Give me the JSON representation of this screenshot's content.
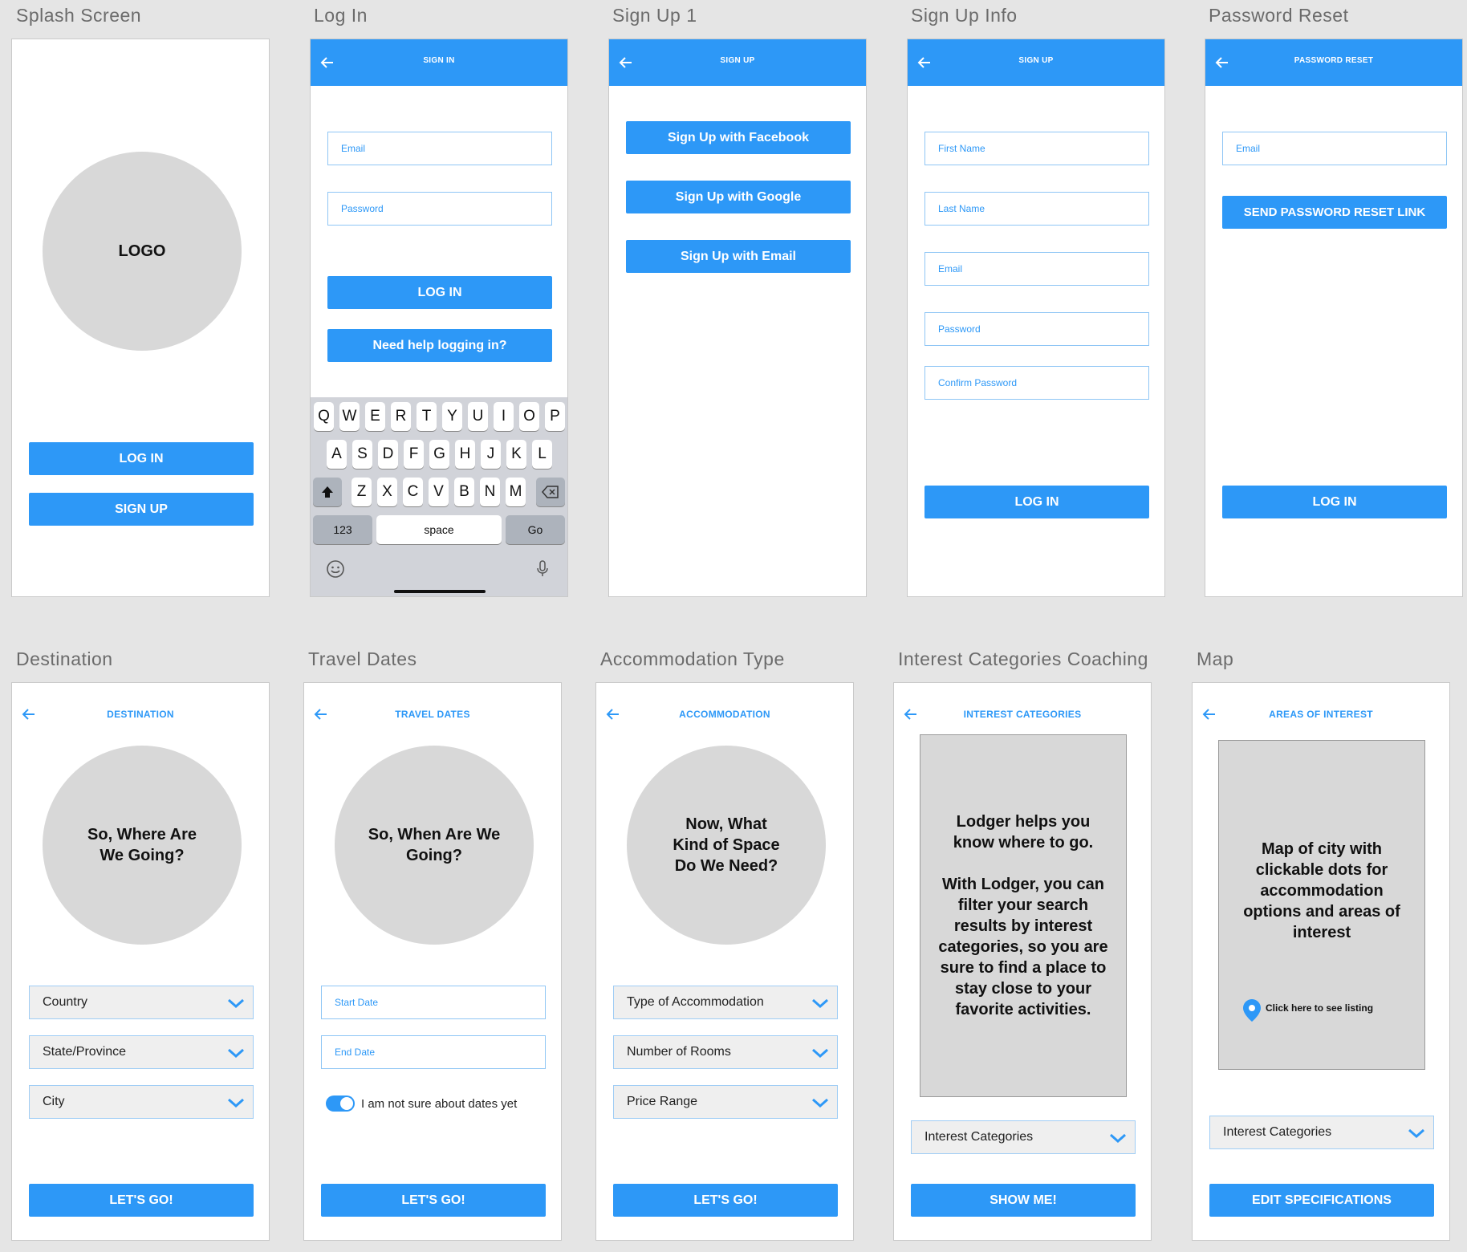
{
  "labels": {
    "splash": "Splash Screen",
    "login": "Log In",
    "signup1": "Sign Up 1",
    "signup_info": "Sign Up Info",
    "password_reset": "Password Reset",
    "destination": "Destination",
    "travel_dates": "Travel Dates",
    "accommodation": "Accommodation Type",
    "interest": "Interest Categories Coaching",
    "map": "Map"
  },
  "splash": {
    "logo": "LOGO",
    "login": "LOG IN",
    "signup": "SIGN UP"
  },
  "login": {
    "title": "SIGN IN",
    "email": "Email",
    "password": "Password",
    "login": "LOG IN",
    "help": "Need help logging in?",
    "keyboard": {
      "row1": [
        "Q",
        "W",
        "E",
        "R",
        "T",
        "Y",
        "U",
        "I",
        "O",
        "P"
      ],
      "row2": [
        "A",
        "S",
        "D",
        "F",
        "G",
        "H",
        "J",
        "K",
        "L"
      ],
      "row3": [
        "Z",
        "X",
        "C",
        "V",
        "B",
        "N",
        "M"
      ],
      "num": "123",
      "space": "space",
      "go": "Go"
    }
  },
  "signup1": {
    "title": "SIGN UP",
    "facebook": "Sign Up with Facebook",
    "google": "Sign Up with Google",
    "email": "Sign Up with Email"
  },
  "signup_info": {
    "title": "SIGN UP",
    "first_name": "First Name",
    "last_name": "Last Name",
    "email": "Email",
    "password": "Password",
    "confirm_password": "Confirm Password",
    "login": "LOG IN"
  },
  "password_reset": {
    "title": "PASSWORD RESET",
    "email": "Email",
    "send": "SEND PASSWORD RESET LINK",
    "login": "LOG IN"
  },
  "destination": {
    "title": "DESTINATION",
    "prompt": "So, Where Are We Going?",
    "country": "Country",
    "state": "State/Province",
    "city": "City",
    "go": "LET'S GO!"
  },
  "travel_dates": {
    "title": "TRAVEL DATES",
    "prompt": "So, When Are We Going?",
    "start": "Start Date",
    "end": "End Date",
    "unsure": "I am not sure about dates yet",
    "go": "LET'S GO!"
  },
  "accommodation": {
    "title": "ACCOMMODATION",
    "prompt": "Now, What Kind of Space Do We Need?",
    "type": "Type of Accommodation",
    "rooms": "Number of Rooms",
    "price": "Price Range",
    "go": "LET'S GO!"
  },
  "interest": {
    "title": "INTEREST CATEGORIES",
    "body": "Lodger helps you know where to go.\n\nWith Lodger, you can filter your search results by interest categories, so you are sure to find a place to stay close to your favorite activities.",
    "select": "Interest Categories",
    "show": "SHOW ME!"
  },
  "map": {
    "title": "AREAS OF INTEREST",
    "body": "Map of city with clickable dots for accommodation options and areas of interest",
    "pin_label": "Click here to see listing",
    "select": "Interest Categories",
    "edit": "EDIT SPECIFICATIONS"
  },
  "colors": {
    "accent": "#2d98f7",
    "placeholder_fill": "#d8d8d8",
    "canvas": "#e5e5e5"
  }
}
